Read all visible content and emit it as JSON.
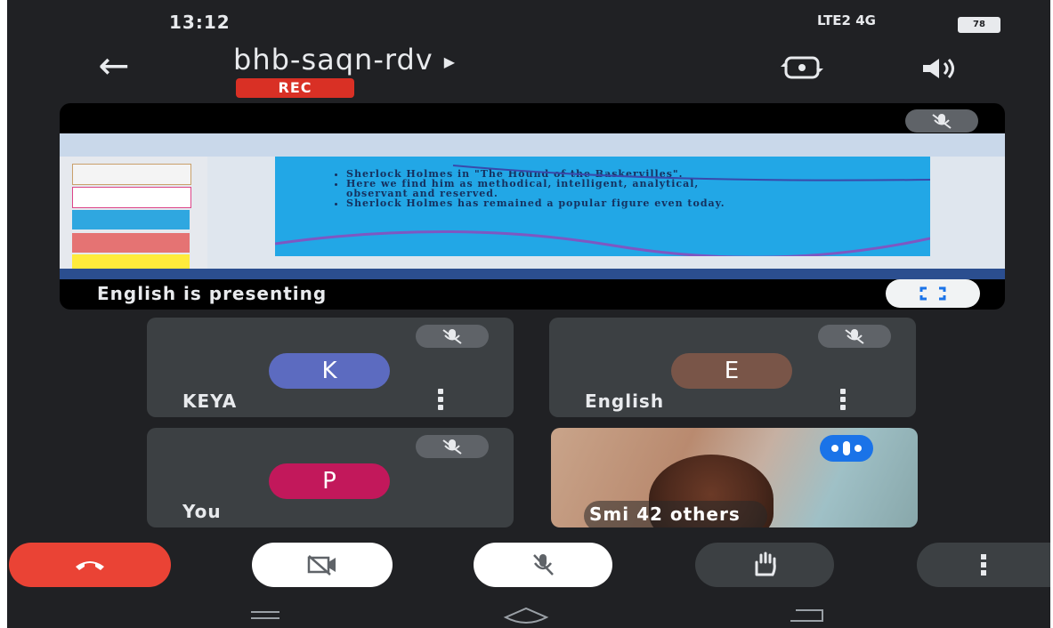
{
  "status_bar": {
    "time": "13:12",
    "right_indicators": "LTE2  4G",
    "battery": "78"
  },
  "header": {
    "meeting_code": "bhb-saqn-rdv",
    "rec_badge": "REC"
  },
  "presentation": {
    "label": "English is presenting",
    "slide_bullets": [
      "Sherlock Holmes in \"The Hound of the Baskervilles\".",
      "Here we find him as methodical, intelligent, analytical,",
      "observant and reserved.",
      "Sherlock Holmes has remained a popular figure even today."
    ]
  },
  "participants": [
    {
      "initial": "K",
      "name": "KEYA",
      "color": "#5c6bc0"
    },
    {
      "initial": "E",
      "name": "English",
      "color": "#795548"
    },
    {
      "initial": "P",
      "name": "You",
      "color": "#c2185b"
    }
  ],
  "video_tile": {
    "others_label": "Smi   42 others"
  },
  "colors": {
    "end_call": "#ea4335",
    "background": "#202124",
    "tile": "#3c4043",
    "speaking": "#1a73e8"
  },
  "icons": {
    "back": "arrow-left-icon",
    "switch_camera": "switch-camera-icon",
    "speaker": "speaker-icon",
    "mic_off": "mic-off-icon",
    "fullscreen": "fullscreen-icon",
    "end_call": "phone-hangup-icon",
    "camera_off": "camera-off-icon",
    "raise_hand": "raise-hand-icon",
    "more": "more-vertical-icon"
  }
}
